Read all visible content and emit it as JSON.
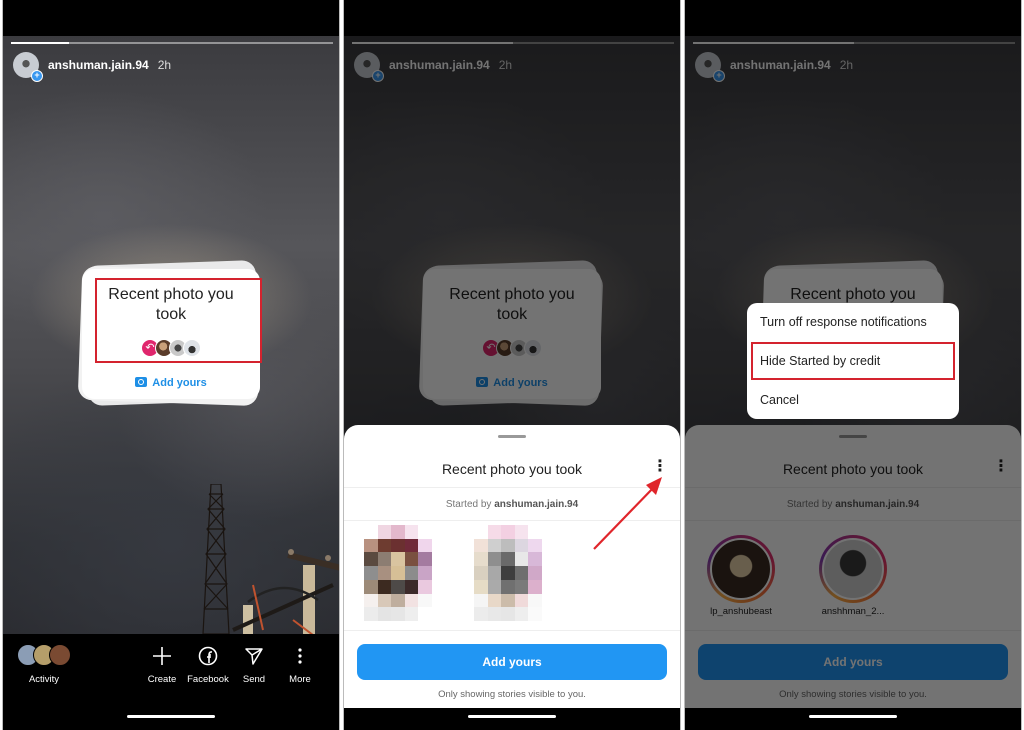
{
  "story": {
    "username": "anshuman.jain.94",
    "time": "2h",
    "progress_fraction": 0.18
  },
  "sticker": {
    "title": "Recent photo you took",
    "add_label": "Add yours"
  },
  "bottom_bar": {
    "activity_label": "Activity",
    "actions": [
      {
        "icon": "plus-icon",
        "label": "Create"
      },
      {
        "icon": "facebook-icon",
        "label": "Facebook"
      },
      {
        "icon": "send-icon",
        "label": "Send"
      },
      {
        "icon": "more-vertical-icon",
        "label": "More"
      }
    ]
  },
  "sheet": {
    "title": "Recent photo you took",
    "started_prefix": "Started by",
    "started_user": "anshuman.jain.94",
    "add_button": "Add yours",
    "footer_note": "Only showing stories visible to you.",
    "participants": [
      {
        "name": "lp_anshubeast"
      },
      {
        "name": "anshhman_2..."
      }
    ]
  },
  "menu": {
    "items": [
      "Turn off response notifications",
      "Hide Started by credit",
      "Cancel"
    ]
  },
  "colors": {
    "accent": "#2196f3",
    "highlight": "#d4232e",
    "reply_badge": "#e0266d"
  }
}
